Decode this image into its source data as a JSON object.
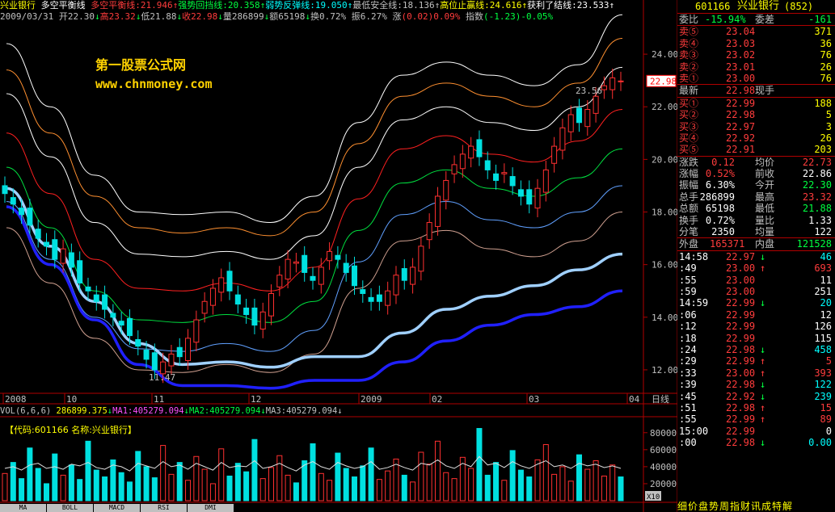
{
  "header": {
    "line1": [
      {
        "t": "兴业银行",
        "c": "yel"
      },
      {
        "t": " 多空平衡线",
        "c": "wht"
      },
      {
        "t": " 多空平衡线:21.946",
        "c": "red"
      },
      {
        "t": "↑",
        "c": "red"
      },
      {
        "t": "强势回挡线:20.358",
        "c": "grn"
      },
      {
        "t": "↑",
        "c": "grn"
      },
      {
        "t": "弱势反弹线:19.050",
        "c": "cyn"
      },
      {
        "t": "↑",
        "c": "cyn"
      },
      {
        "t": "最低安全线:18.136",
        "c": "gry"
      },
      {
        "t": "↑",
        "c": "gry"
      },
      {
        "t": "高位止赢线:24.616",
        "c": "yel"
      },
      {
        "t": "↑",
        "c": "yel"
      },
      {
        "t": "获利了结线:23.533",
        "c": "wht"
      },
      {
        "t": "↑",
        "c": "wht"
      }
    ],
    "line2": [
      {
        "t": "2009/03/31",
        "c": "gry"
      },
      {
        "t": " 开22.30",
        "c": "gry"
      },
      {
        "t": "↓",
        "c": "grn"
      },
      {
        "t": "高23.32",
        "c": "red"
      },
      {
        "t": "↓",
        "c": "grn"
      },
      {
        "t": "低21.88",
        "c": "gry"
      },
      {
        "t": "↓",
        "c": "grn"
      },
      {
        "t": "收22.98",
        "c": "red"
      },
      {
        "t": "↓",
        "c": "grn"
      },
      {
        "t": "量286899",
        "c": "gry"
      },
      {
        "t": "↓",
        "c": "grn"
      },
      {
        "t": "额65198",
        "c": "gry"
      },
      {
        "t": "↓",
        "c": "grn"
      },
      {
        "t": "换0.72%",
        "c": "gry"
      },
      {
        "t": " 振6.27%",
        "c": "gry"
      },
      {
        "t": " 涨",
        "c": "gry"
      },
      {
        "t": "(0.02)0.09%",
        "c": "red"
      },
      {
        "t": " 指数",
        "c": "gry"
      },
      {
        "t": "(-1.23)-0.05%",
        "c": "grn"
      }
    ]
  },
  "watermark": {
    "name": "第一股票公式网",
    "url": "www.chnmoney.com"
  },
  "chart_data": {
    "type": "line",
    "title": "",
    "ylim": [
      11.2,
      25.2
    ],
    "yticks": [
      12.0,
      14.0,
      16.0,
      18.0,
      20.0,
      22.0,
      24.0
    ],
    "ytick_labels": [
      "12.00",
      "14.00",
      "16.00",
      "18.00",
      "20.00",
      "22.00",
      "24.00"
    ],
    "current_price": "22.98",
    "xticks": [
      "2008",
      "10",
      "11",
      "12",
      "2009",
      "02",
      "03",
      "04"
    ],
    "period_label": "日线",
    "annotations": [
      {
        "text": "23.56"
      },
      {
        "text": "11.47"
      }
    ],
    "series": [
      {
        "name": "获利了结线",
        "color": "#ffffff",
        "values": [
          24.4,
          22.0,
          19.4,
          18.0,
          17.9,
          18.0,
          17.6,
          18.6,
          21.4,
          23.2,
          23.7,
          23.2,
          22.8,
          23.6,
          25.5
        ]
      },
      {
        "name": "高位止赢线",
        "color": "#ff9030",
        "values": [
          23.4,
          21.0,
          18.6,
          17.4,
          17.2,
          17.4,
          17.1,
          18.0,
          20.6,
          22.4,
          22.9,
          22.4,
          22.0,
          22.9,
          24.6
        ]
      },
      {
        "name": "多空平衡线",
        "color": "#ffffff",
        "values": [
          22.5,
          20.1,
          17.6,
          16.4,
          16.3,
          16.5,
          16.2,
          17.1,
          19.7,
          21.5,
          22.0,
          21.4,
          21.1,
          22.0,
          23.5
        ]
      },
      {
        "name": "强势回挡线",
        "color": "#ff2020",
        "values": [
          21.0,
          18.7,
          16.2,
          15.1,
          15.0,
          15.3,
          15.0,
          15.9,
          18.5,
          20.4,
          20.9,
          20.2,
          19.9,
          20.7,
          21.9
        ]
      },
      {
        "name": "弱势反弹线",
        "color": "#00e040",
        "values": [
          19.7,
          17.4,
          15.0,
          13.9,
          13.8,
          14.1,
          13.8,
          14.6,
          17.3,
          19.1,
          19.6,
          18.9,
          18.6,
          19.3,
          20.4
        ]
      },
      {
        "name": "最低安全线",
        "color": "#60a0ff",
        "values": [
          18.4,
          16.2,
          14.0,
          12.8,
          12.7,
          13.0,
          12.7,
          13.5,
          16.1,
          17.9,
          18.4,
          17.7,
          17.4,
          18.0,
          19.0
        ]
      },
      {
        "name": "",
        "color": "#d0a090",
        "values": [
          17.4,
          15.3,
          13.2,
          12.0,
          11.9,
          12.2,
          11.9,
          12.6,
          15.1,
          16.9,
          17.3,
          16.6,
          16.3,
          16.9,
          18.0
        ]
      },
      {
        "name": "",
        "color": "#a0d0ff",
        "values": [
          18.9,
          16.7,
          14.6,
          13.0,
          12.2,
          12.3,
          12.1,
          12.5,
          12.5,
          13.4,
          14.3,
          14.8,
          15.2,
          15.8,
          16.4
        ]
      },
      {
        "name": "",
        "color": "#2020ff",
        "values": [
          18.2,
          16.0,
          13.9,
          12.2,
          11.4,
          11.4,
          11.3,
          11.6,
          11.6,
          12.3,
          13.1,
          13.7,
          14.1,
          14.4,
          15.0
        ]
      }
    ],
    "candle_closes": [
      18.7,
      18.3,
      17.9,
      17.5,
      17.0,
      16.7,
      16.2,
      16.6,
      15.9,
      15.3,
      15.0,
      14.6,
      14.3,
      14.0,
      13.7,
      13.3,
      12.9,
      12.4,
      12.0,
      12.3,
      12.6,
      12.5,
      13.2,
      13.9,
      14.6,
      15.1,
      15.5,
      15.0,
      14.5,
      14.1,
      13.7,
      14.2,
      14.9,
      15.6,
      16.2,
      16.1,
      15.7,
      15.4,
      15.9,
      16.5,
      16.2,
      15.7,
      15.2,
      14.9,
      14.6,
      14.6,
      15.0,
      15.6,
      15.4,
      15.9,
      16.7,
      17.6,
      18.6,
      19.2,
      19.8,
      20.2,
      20.5,
      20.1,
      19.6,
      19.2,
      19.5,
      19.0,
      18.6,
      18.3,
      18.9,
      19.6,
      20.5,
      21.2,
      21.7,
      21.4,
      21.9,
      22.4,
      22.8,
      23.1,
      22.98
    ]
  },
  "volume": {
    "header": [
      {
        "t": "VOL(6,6,6) ",
        "c": "gry"
      },
      {
        "t": "286899.375",
        "c": "yel"
      },
      {
        "t": "↓",
        "c": "grn"
      },
      {
        "t": "MA1:405279.094",
        "c": "mag"
      },
      {
        "t": "↓",
        "c": "grn"
      },
      {
        "t": "MA2:405279.094",
        "c": "grn"
      },
      {
        "t": "↓",
        "c": "grn"
      },
      {
        "t": "MA3:405279.094",
        "c": "gry"
      },
      {
        "t": "↓",
        "c": "gry"
      }
    ],
    "code_label": "【代码:601166 名称:兴业银行】",
    "yticks": [
      "80000",
      "60000",
      "40000",
      "20000"
    ],
    "unit": "X10",
    "ymax": 95000,
    "bars": [
      32000,
      45000,
      26000,
      62000,
      38000,
      20000,
      55000,
      30000,
      42000,
      25000,
      70000,
      36000,
      28000,
      48000,
      33000,
      22000,
      58000,
      40000,
      27000,
      65000,
      31000,
      45000,
      24000,
      52000,
      37000,
      20000,
      61000,
      29000,
      44000,
      34000,
      72000,
      26000,
      39000,
      53000,
      30000,
      21000,
      47000,
      67000,
      32000,
      24000,
      56000,
      38000,
      28000,
      41000,
      62000,
      25000,
      35000,
      49000,
      30000,
      22000,
      57000,
      43000,
      70000,
      33000,
      26000,
      51000,
      38000,
      85000,
      30000,
      45000,
      24000,
      59000,
      36000,
      28000,
      48000,
      66000,
      31000,
      40000,
      23000,
      54000,
      37000,
      47000,
      29000,
      42000,
      28000
    ],
    "ma_line": [
      38000,
      40000,
      36000,
      42000,
      44000,
      38000,
      40000,
      37000,
      43000,
      41000,
      45000,
      39000,
      37000,
      42000,
      40000,
      35000,
      44000,
      41000,
      38000,
      46000,
      40000,
      42000,
      37000,
      44000,
      40000,
      36000,
      45000,
      39000,
      41000,
      40000,
      47000,
      38000,
      40000,
      44000,
      39000,
      35000,
      42000,
      46000,
      40000,
      37000,
      45000,
      41000,
      38000,
      40000,
      46000,
      37000,
      39000,
      43000,
      39000,
      36000,
      44000,
      42000,
      48000,
      41000,
      38000,
      44000,
      40000,
      52000,
      42000,
      44000,
      39000,
      46000,
      41000,
      38000,
      43000,
      47000,
      40000,
      42000,
      38000,
      44000,
      41000,
      43000,
      39000,
      41000,
      38000
    ]
  },
  "tabs": [
    "MA",
    "BOLL",
    "MACD",
    "RSI",
    "DMI"
  ],
  "quote": {
    "code": "601166",
    "name": "兴业银行",
    "exch": "(852)",
    "weibi_label": "委比",
    "weibi_val": "-15.94%",
    "weicha_label": "委差",
    "weicha_val": "-161",
    "sells": [
      {
        "l": "卖⑤",
        "p": "23.04",
        "v": "371"
      },
      {
        "l": "卖④",
        "p": "23.03",
        "v": "36"
      },
      {
        "l": "卖③",
        "p": "23.02",
        "v": "76"
      },
      {
        "l": "卖②",
        "p": "23.01",
        "v": "26"
      },
      {
        "l": "卖①",
        "p": "23.00",
        "v": "76"
      }
    ],
    "latest": {
      "l": "最新",
      "p": "22.98",
      "x": "现手"
    },
    "buys": [
      {
        "l": "买①",
        "p": "22.99",
        "v": "188"
      },
      {
        "l": "买②",
        "p": "22.98",
        "v": "5"
      },
      {
        "l": "买③",
        "p": "22.97",
        "v": "3"
      },
      {
        "l": "买④",
        "p": "22.92",
        "v": "26"
      },
      {
        "l": "买⑤",
        "p": "22.91",
        "v": "203"
      }
    ],
    "stats": [
      {
        "a": "涨跌",
        "b": "0.12",
        "c": "均价",
        "d": "22.73",
        "bc": "red",
        "dc": "red"
      },
      {
        "a": "涨幅",
        "b": "0.52%",
        "c": "前收",
        "d": "22.86",
        "bc": "red",
        "dc": "wht"
      },
      {
        "a": "振幅",
        "b": "6.30%",
        "c": "今开",
        "d": "22.30",
        "bc": "wht",
        "dc": "grn"
      },
      {
        "a": "总手",
        "b": "286899",
        "c": "最高",
        "d": "23.32",
        "bc": "wht",
        "dc": "red"
      },
      {
        "a": "总额",
        "b": "65198",
        "c": "最低",
        "d": "21.88",
        "bc": "wht",
        "dc": "grn"
      },
      {
        "a": "换手",
        "b": "0.72%",
        "c": "量比",
        "d": "1.33",
        "bc": "wht",
        "dc": "wht"
      },
      {
        "a": "分笔",
        "b": "2350",
        "c": "均量",
        "d": "122",
        "bc": "wht",
        "dc": "wht"
      }
    ],
    "outer": {
      "l": "外盘",
      "v": "165371",
      "l2": "内盘",
      "v2": "121528"
    },
    "ticks": [
      {
        "t": "14:58",
        "p": "22.97",
        "a": "↓",
        "v": "46",
        "pc": "red",
        "ac": "grn",
        "vc": "cyn"
      },
      {
        "t": ":49",
        "p": "23.00",
        "a": "↑",
        "v": "693",
        "pc": "red",
        "ac": "red",
        "vc": "red"
      },
      {
        "t": ":55",
        "p": "23.00",
        "a": "",
        "v": "11",
        "pc": "red",
        "ac": "red",
        "vc": "wht"
      },
      {
        "t": ":59",
        "p": "23.00",
        "a": "",
        "v": "251",
        "pc": "red",
        "ac": "red",
        "vc": "wht"
      },
      {
        "t": "14:59",
        "p": "22.99",
        "a": "↓",
        "v": "20",
        "pc": "red",
        "ac": "grn",
        "vc": "cyn"
      },
      {
        "t": ":06",
        "p": "22.99",
        "a": "",
        "v": "12",
        "pc": "red",
        "ac": "grn",
        "vc": "wht"
      },
      {
        "t": ":12",
        "p": "22.99",
        "a": "",
        "v": "126",
        "pc": "red",
        "ac": "grn",
        "vc": "wht"
      },
      {
        "t": ":18",
        "p": "22.99",
        "a": "",
        "v": "115",
        "pc": "red",
        "ac": "grn",
        "vc": "wht"
      },
      {
        "t": ":24",
        "p": "22.98",
        "a": "↓",
        "v": "458",
        "pc": "red",
        "ac": "grn",
        "vc": "cyn"
      },
      {
        "t": ":29",
        "p": "22.99",
        "a": "↑",
        "v": "5",
        "pc": "red",
        "ac": "red",
        "vc": "red"
      },
      {
        "t": ":33",
        "p": "23.00",
        "a": "↑",
        "v": "393",
        "pc": "red",
        "ac": "red",
        "vc": "red"
      },
      {
        "t": ":39",
        "p": "22.98",
        "a": "↓",
        "v": "122",
        "pc": "red",
        "ac": "grn",
        "vc": "cyn"
      },
      {
        "t": ":45",
        "p": "22.92",
        "a": "↓",
        "v": "239",
        "pc": "red",
        "ac": "grn",
        "vc": "cyn"
      },
      {
        "t": ":51",
        "p": "22.98",
        "a": "↑",
        "v": "15",
        "pc": "red",
        "ac": "red",
        "vc": "red"
      },
      {
        "t": ":55",
        "p": "22.99",
        "a": "↑",
        "v": "89",
        "pc": "red",
        "ac": "red",
        "vc": "red"
      },
      {
        "t": "15:00",
        "p": "22.99",
        "a": "",
        "v": "0",
        "pc": "red",
        "ac": "red",
        "vc": "wht"
      },
      {
        "t": ":00",
        "p": "22.98",
        "a": "↓",
        "v": "0.00",
        "pc": "red",
        "ac": "grn",
        "vc": "cyn"
      }
    ],
    "bottom_tabs": "细价盘势周指财讯成特解"
  }
}
